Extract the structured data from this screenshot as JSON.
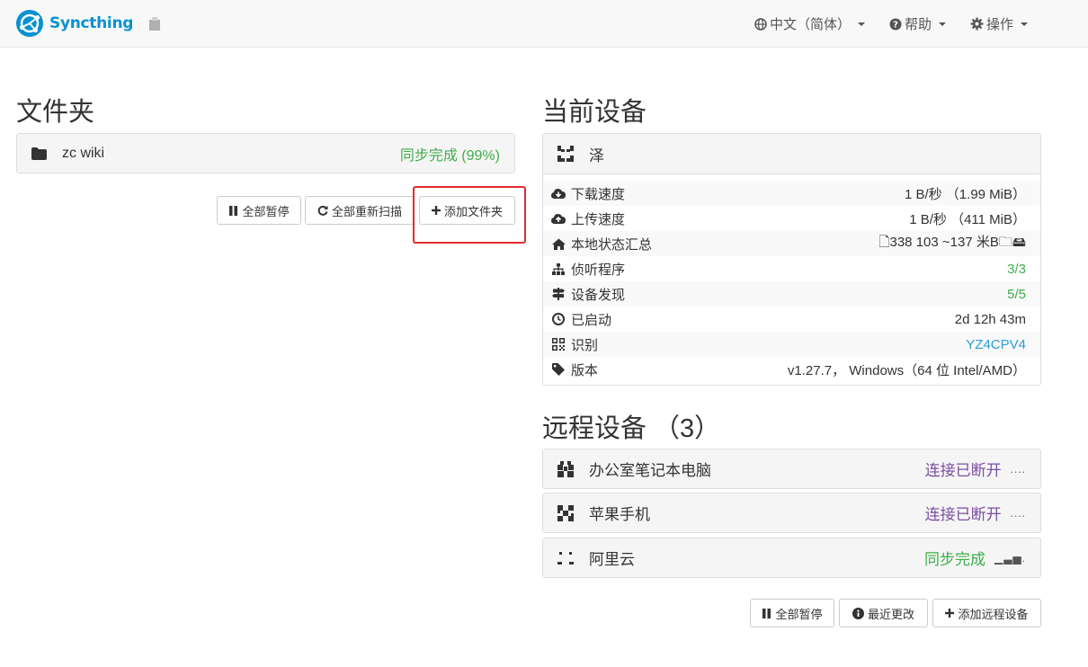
{
  "navbar": {
    "brand": "Syncthing",
    "language": "中文（简体）",
    "help": "帮助",
    "actions": "操作"
  },
  "folders": {
    "heading": "文件夹",
    "items": [
      {
        "name": "zc  wiki",
        "status": "同步完成 (99%)"
      }
    ],
    "buttons": {
      "pause_all": "全部暂停",
      "rescan_all": "全部重新扫描",
      "add_folder": "添加文件夹"
    }
  },
  "this_device": {
    "heading": "当前设备",
    "name": "泽",
    "rows": [
      {
        "icon": "cloud-download-icon",
        "label": "下载速度",
        "value": "1 B/秒 （1.99 MiB）"
      },
      {
        "icon": "cloud-upload-icon",
        "label": "上传速度",
        "value": "1 B/秒 （411 MiB）"
      },
      {
        "icon": "home-icon",
        "label": "本地状态汇总",
        "value": "🗋338 103 ~137 米B🗀🖴"
      },
      {
        "icon": "sitemap-icon",
        "label": "侦听程序",
        "value": "3/3"
      },
      {
        "icon": "signpost-icon",
        "label": "设备发现",
        "value": "5/5"
      },
      {
        "icon": "clock-icon",
        "label": "已启动",
        "value": "2d 12h 43m"
      },
      {
        "icon": "qrcode-icon",
        "label": "识别",
        "value": "YZ4CPV4"
      },
      {
        "icon": "tag-icon",
        "label": "版本",
        "value": "v1.27.7， Windows（64 位 Intel/AMD）"
      }
    ]
  },
  "remote_devices": {
    "heading": "远程设备 （3）",
    "items": [
      {
        "name": "办公室笔记本电脑",
        "status": "连接已断开",
        "signal": "....",
        "status_color": "#7b4fa2"
      },
      {
        "name": "苹果手机",
        "status": "连接已断开",
        "signal": "....",
        "status_color": "#7b4fa2"
      },
      {
        "name": "阿里云",
        "status": "同步完成",
        "signal": "▁▃▅.",
        "status_color": "#3fae49"
      }
    ],
    "buttons": {
      "pause_all": "全部暂停",
      "recent_changes": "最近更改",
      "add_remote": "添加远程设备"
    }
  },
  "colors": {
    "brand": "#0891d1",
    "green": "#3fae49",
    "purple": "#7b4fa2",
    "blue": "#2a9fd6",
    "highlight": "#e32c2c"
  }
}
